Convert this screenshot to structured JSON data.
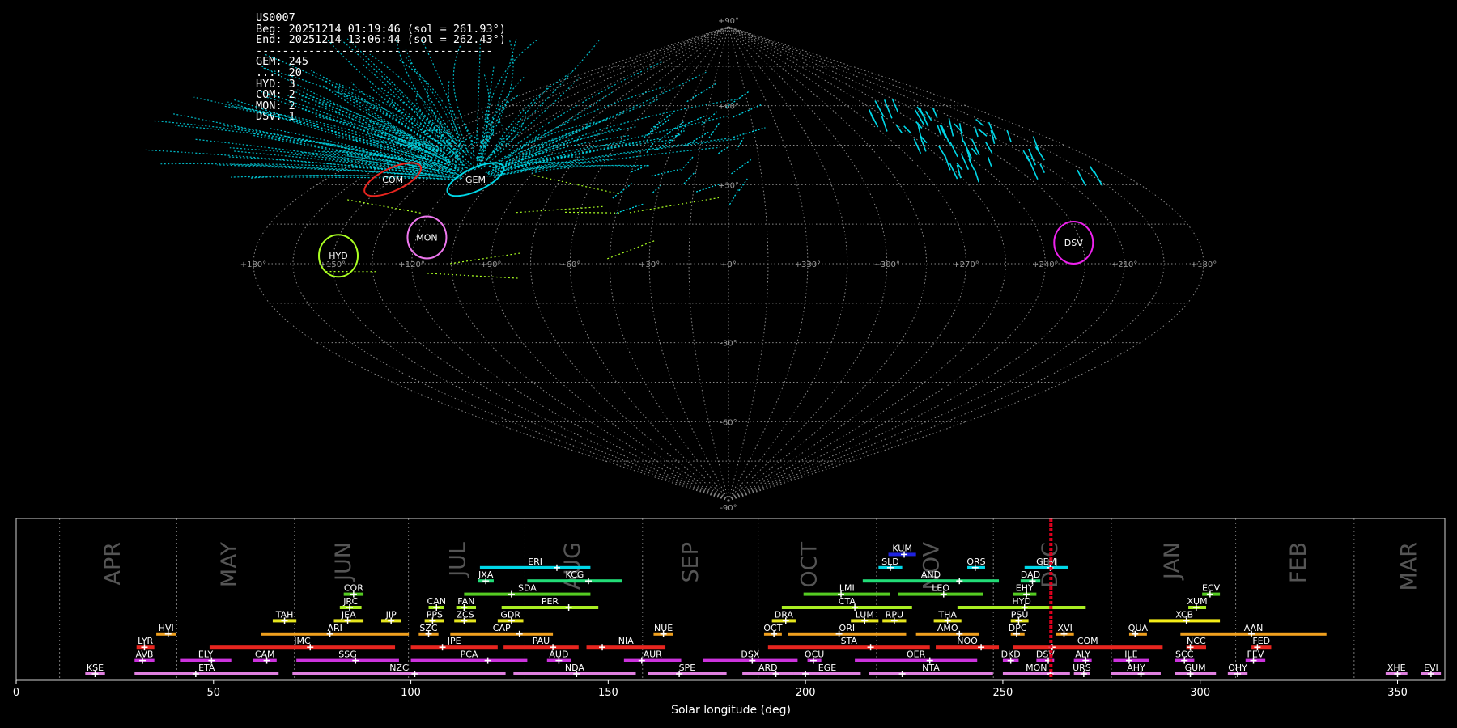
{
  "header": {
    "station": "US0007",
    "begin": "Beg: 20251214 01:19:46 (sol = 261.93°)",
    "end": "End: 20251214 13:06:44 (sol = 262.43°)",
    "separator": "------------------------------------",
    "counts": [
      "GEM: 245",
      "...: 20",
      "HYD: 3",
      "COM: 2",
      "MON: 2",
      "DSV: 1"
    ]
  },
  "chart_data": [
    {
      "type": "scatter",
      "projection": "sinusoidal",
      "center_lon": 0,
      "lon_direction": "increasing to the left",
      "lon_labels": [
        "+180°",
        "+150°",
        "+120°",
        "+90°",
        "+60°",
        "+30°",
        "+0°",
        "+330°",
        "+300°",
        "+270°",
        "+240°",
        "+210°",
        "+180°"
      ],
      "lon_ticks": [
        180,
        150,
        120,
        90,
        60,
        30,
        0,
        -30,
        -60,
        -90,
        -120,
        -150,
        -180
      ],
      "lat_labels": [
        "+90°",
        "+60°",
        "+30°",
        "-30°",
        "-60°",
        "-90°"
      ],
      "lat_ticks": [
        90,
        60,
        30,
        -30,
        -60,
        -90
      ],
      "grid": true,
      "radiants": [
        {
          "name": "COM",
          "lon": 150,
          "lat": 32,
          "color": "#e8251f"
        },
        {
          "name": "GEM",
          "lon": 113,
          "lat": 32,
          "color": "#00d8e8"
        },
        {
          "name": "HYD",
          "lon": 148,
          "lat": 3,
          "color": "#aaff22"
        },
        {
          "name": "MON",
          "lon": 116,
          "lat": 10,
          "color": "#ee77ee"
        },
        {
          "name": "DSV",
          "lon": -132,
          "lat": 8,
          "color": "#ee22ee"
        }
      ],
      "meteor_colors": {
        "GEM": "#00d8e8",
        "sporadic": "#aaff22"
      }
    },
    {
      "type": "timeline",
      "xlabel": "Solar longitude (deg)",
      "xlim": [
        0,
        362
      ],
      "xticks": [
        0,
        50,
        100,
        150,
        200,
        250,
        300,
        350
      ],
      "current_sol": [
        261.93,
        262.43
      ],
      "current_color": "#e8001f",
      "month_boundaries": [
        11,
        40.7,
        70.5,
        99.4,
        128.9,
        158.7,
        188,
        218,
        247.6,
        277.5,
        309,
        339
      ],
      "months": [
        {
          "label": "APR",
          "sol": 24.5
        },
        {
          "label": "MAY",
          "sol": 54
        },
        {
          "label": "JUN",
          "sol": 83
        },
        {
          "label": "JUL",
          "sol": 112
        },
        {
          "label": "AUG",
          "sol": 141
        },
        {
          "label": "SEP",
          "sol": 171
        },
        {
          "label": "OCT",
          "sol": 201
        },
        {
          "label": "NOV",
          "sol": 232
        },
        {
          "label": "DEC",
          "sol": 262
        },
        {
          "label": "JAN",
          "sol": 293
        },
        {
          "label": "FEB",
          "sol": 325
        },
        {
          "label": "MAR",
          "sol": 353
        }
      ],
      "showers": [
        {
          "code": "KUM",
          "start": 221,
          "end": 228,
          "peak": 225,
          "row": 9,
          "color": "#1e22e0"
        },
        {
          "code": "ERI",
          "start": 117.5,
          "end": 145.5,
          "peak": 137,
          "row": 8,
          "color": "#00d8e8"
        },
        {
          "code": "SLD",
          "start": 218.5,
          "end": 224.5,
          "peak": 221.5,
          "row": 8,
          "color": "#00d8e8"
        },
        {
          "code": "ORS",
          "start": 241,
          "end": 245.5,
          "peak": 243,
          "row": 8,
          "color": "#00d8e8"
        },
        {
          "code": "GEM",
          "start": 255.5,
          "end": 266.5,
          "peak": 262,
          "row": 8,
          "color": "#00d8e8"
        },
        {
          "code": "JXA",
          "start": 117,
          "end": 121,
          "peak": 119,
          "row": 7,
          "color": "#22dd77"
        },
        {
          "code": "KCG",
          "start": 129.5,
          "end": 153.5,
          "peak": 145,
          "row": 7,
          "color": "#22dd77"
        },
        {
          "code": "AND",
          "start": 214.5,
          "end": 249,
          "peak": 239,
          "row": 7,
          "color": "#22dd77"
        },
        {
          "code": "DAD",
          "start": 254.5,
          "end": 259.5,
          "peak": 257.5,
          "row": 7,
          "color": "#22dd77"
        },
        {
          "code": "COR",
          "start": 83,
          "end": 88,
          "peak": 85.5,
          "row": 6,
          "color": "#55cc22"
        },
        {
          "code": "SDA",
          "start": 113.5,
          "end": 145.5,
          "peak": 125.5,
          "row": 6,
          "color": "#55cc22"
        },
        {
          "code": "LMI",
          "start": 199.5,
          "end": 221.5,
          "peak": 209,
          "row": 6,
          "color": "#55cc22"
        },
        {
          "code": "LEO",
          "start": 223.5,
          "end": 245,
          "peak": 235,
          "row": 6,
          "color": "#55cc22"
        },
        {
          "code": "EHY",
          "start": 252.5,
          "end": 258.5,
          "peak": 256,
          "row": 6,
          "color": "#55cc22"
        },
        {
          "code": "ECV",
          "start": 300.5,
          "end": 305,
          "peak": 302.5,
          "row": 6,
          "color": "#55cc22"
        },
        {
          "code": "JRC",
          "start": 82,
          "end": 87.5,
          "peak": 84.5,
          "row": 5,
          "color": "#aaee22"
        },
        {
          "code": "CAN",
          "start": 104.5,
          "end": 108.5,
          "peak": 106.5,
          "row": 5,
          "color": "#aaee22"
        },
        {
          "code": "FAN",
          "start": 111.5,
          "end": 116.5,
          "peak": 113.5,
          "row": 5,
          "color": "#aaee22"
        },
        {
          "code": "PER",
          "start": 123,
          "end": 147.5,
          "peak": 140,
          "row": 5,
          "color": "#aaee22"
        },
        {
          "code": "CTA",
          "start": 194,
          "end": 227,
          "peak": 212.5,
          "row": 5,
          "color": "#aaee22"
        },
        {
          "code": "HYD",
          "start": 238.5,
          "end": 271,
          "peak": 255.5,
          "row": 5,
          "color": "#aaee22"
        },
        {
          "code": "XUM",
          "start": 297,
          "end": 301.5,
          "peak": 299,
          "row": 5,
          "color": "#aaee22"
        },
        {
          "code": "TAH",
          "start": 65,
          "end": 71,
          "peak": 68,
          "row": 4,
          "color": "#e6e61e"
        },
        {
          "code": "JEA",
          "start": 80.5,
          "end": 88,
          "peak": 84,
          "row": 4,
          "color": "#e6e61e"
        },
        {
          "code": "JIP",
          "start": 92.5,
          "end": 97.5,
          "peak": 95,
          "row": 4,
          "color": "#e6e61e"
        },
        {
          "code": "PPS",
          "start": 103.5,
          "end": 108.5,
          "peak": 105.5,
          "row": 4,
          "color": "#e6e61e"
        },
        {
          "code": "ZCS",
          "start": 111,
          "end": 116.5,
          "peak": 113.5,
          "row": 4,
          "color": "#e6e61e"
        },
        {
          "code": "GDR",
          "start": 122,
          "end": 128.5,
          "peak": 125.5,
          "row": 4,
          "color": "#e6e61e"
        },
        {
          "code": "DRA",
          "start": 191.5,
          "end": 197.5,
          "peak": 195,
          "row": 4,
          "color": "#e6e61e"
        },
        {
          "code": "LUM",
          "start": 211.5,
          "end": 218.5,
          "peak": 215,
          "row": 4,
          "color": "#e6e61e"
        },
        {
          "code": "RPU",
          "start": 219.5,
          "end": 225.5,
          "peak": 222.5,
          "row": 4,
          "color": "#e6e61e"
        },
        {
          "code": "THA",
          "start": 232.5,
          "end": 239.5,
          "peak": 236,
          "row": 4,
          "color": "#e6e61e"
        },
        {
          "code": "PSU",
          "start": 252,
          "end": 256.5,
          "peak": 254,
          "row": 4,
          "color": "#e6e61e"
        },
        {
          "code": "XCB",
          "start": 287,
          "end": 305,
          "peak": 296.5,
          "row": 4,
          "color": "#f5ee18"
        },
        {
          "code": "HVI",
          "start": 35.5,
          "end": 40.5,
          "peak": 38.5,
          "row": 3,
          "color": "#f0a01e"
        },
        {
          "code": "ARI",
          "start": 62,
          "end": 99.5,
          "peak": 79.5,
          "row": 3,
          "color": "#f0a01e"
        },
        {
          "code": "SZC",
          "start": 102,
          "end": 107,
          "peak": 104.5,
          "row": 3,
          "color": "#f0a01e"
        },
        {
          "code": "CAP",
          "start": 110,
          "end": 136,
          "peak": 127.5,
          "row": 3,
          "color": "#f0a01e"
        },
        {
          "code": "NUE",
          "start": 161.5,
          "end": 166.5,
          "peak": 164,
          "row": 3,
          "color": "#f0a01e"
        },
        {
          "code": "OCT",
          "start": 189.5,
          "end": 194,
          "peak": 192,
          "row": 3,
          "color": "#f0a01e"
        },
        {
          "code": "ORI",
          "start": 195.5,
          "end": 225.5,
          "peak": 208.5,
          "row": 3,
          "color": "#f0a01e"
        },
        {
          "code": "AMO",
          "start": 228,
          "end": 244,
          "peak": 239,
          "row": 3,
          "color": "#f0a01e"
        },
        {
          "code": "DPC",
          "start": 252,
          "end": 255.5,
          "peak": 253.5,
          "row": 3,
          "color": "#f0a01e"
        },
        {
          "code": "XVI",
          "start": 263.5,
          "end": 268,
          "peak": 265.5,
          "row": 3,
          "color": "#f0a01e"
        },
        {
          "code": "QUA",
          "start": 282,
          "end": 286.5,
          "peak": 283.5,
          "row": 3,
          "color": "#f0a01e"
        },
        {
          "code": "AAN",
          "start": 295,
          "end": 332,
          "peak": 313,
          "row": 3,
          "color": "#f0a01e"
        },
        {
          "code": "LYR",
          "start": 30.5,
          "end": 35,
          "peak": 32.5,
          "row": 2,
          "color": "#e8251f"
        },
        {
          "code": "JMC",
          "start": 49,
          "end": 96,
          "peak": 74.5,
          "row": 2,
          "color": "#e8251f"
        },
        {
          "code": "JPE",
          "start": 100,
          "end": 122,
          "peak": 108,
          "row": 2,
          "color": "#e8251f"
        },
        {
          "code": "PAU",
          "start": 123.5,
          "end": 142.5,
          "peak": 136,
          "row": 2,
          "color": "#e8251f"
        },
        {
          "code": "NIA",
          "start": 144.5,
          "end": 164.5,
          "peak": 148.5,
          "row": 2,
          "color": "#e8251f"
        },
        {
          "code": "STA",
          "start": 190.5,
          "end": 231.5,
          "peak": 216.5,
          "row": 2,
          "color": "#e8251f"
        },
        {
          "code": "NOO",
          "start": 233,
          "end": 249,
          "peak": 244.5,
          "row": 2,
          "color": "#e8251f"
        },
        {
          "code": "COM",
          "start": 252.5,
          "end": 290.5,
          "peak": 262.5,
          "row": 2,
          "color": "#e8251f"
        },
        {
          "code": "NCC",
          "start": 296.5,
          "end": 301.5,
          "peak": 297.5,
          "row": 2,
          "color": "#e8251f"
        },
        {
          "code": "FED",
          "start": 313,
          "end": 318,
          "peak": 314.5,
          "row": 2,
          "color": "#e8251f"
        },
        {
          "code": "AVB",
          "start": 30,
          "end": 35,
          "peak": 32,
          "row": 1,
          "color": "#cc33dd"
        },
        {
          "code": "ELY",
          "start": 41.5,
          "end": 54.5,
          "peak": 49.5,
          "row": 1,
          "color": "#cc33dd"
        },
        {
          "code": "CAM",
          "start": 60,
          "end": 66,
          "peak": 63.5,
          "row": 1,
          "color": "#cc33dd"
        },
        {
          "code": "SSG",
          "start": 71,
          "end": 97,
          "peak": 86,
          "row": 1,
          "color": "#cc33dd"
        },
        {
          "code": "PCA",
          "start": 100,
          "end": 129.5,
          "peak": 119.5,
          "row": 1,
          "color": "#cc33dd"
        },
        {
          "code": "AUD",
          "start": 134.5,
          "end": 140.5,
          "peak": 137.5,
          "row": 1,
          "color": "#cc33dd"
        },
        {
          "code": "AUR",
          "start": 154,
          "end": 168.5,
          "peak": 158.5,
          "row": 1,
          "color": "#cc33dd"
        },
        {
          "code": "DSX",
          "start": 174,
          "end": 198,
          "peak": 186.5,
          "row": 1,
          "color": "#cc33dd"
        },
        {
          "code": "OCU",
          "start": 200.5,
          "end": 204,
          "peak": 202,
          "row": 1,
          "color": "#cc33dd"
        },
        {
          "code": "OER",
          "start": 212.5,
          "end": 243.5,
          "peak": 231.5,
          "row": 1,
          "color": "#cc33dd"
        },
        {
          "code": "DKD",
          "start": 250,
          "end": 254,
          "peak": 252,
          "row": 1,
          "color": "#cc33dd"
        },
        {
          "code": "DSV",
          "start": 258.5,
          "end": 263,
          "peak": 261.5,
          "row": 1,
          "color": "#cc33dd"
        },
        {
          "code": "ALY",
          "start": 268,
          "end": 272.5,
          "peak": 271,
          "row": 1,
          "color": "#cc33dd"
        },
        {
          "code": "ILE",
          "start": 278,
          "end": 287,
          "peak": 282,
          "row": 1,
          "color": "#cc33dd"
        },
        {
          "code": "SCC",
          "start": 293.5,
          "end": 298.5,
          "peak": 296,
          "row": 1,
          "color": "#cc33dd"
        },
        {
          "code": "FEV",
          "start": 311.5,
          "end": 316.5,
          "peak": 313.5,
          "row": 1,
          "color": "#cc33dd"
        },
        {
          "code": "KSE",
          "start": 17.5,
          "end": 22.5,
          "peak": 20,
          "row": 0,
          "color": "#e080e0"
        },
        {
          "code": "ETA",
          "start": 30,
          "end": 66.5,
          "peak": 45.5,
          "row": 0,
          "color": "#e080e0"
        },
        {
          "code": "NZC",
          "start": 70,
          "end": 124,
          "peak": 101,
          "row": 0,
          "color": "#e080e0"
        },
        {
          "code": "NDA",
          "start": 126,
          "end": 157,
          "peak": 142,
          "row": 0,
          "color": "#e080e0"
        },
        {
          "code": "SPE",
          "start": 160,
          "end": 180,
          "peak": 168,
          "row": 0,
          "color": "#e080e0"
        },
        {
          "code": "ARD",
          "start": 184,
          "end": 197,
          "peak": 192.5,
          "row": 0,
          "color": "#e080e0"
        },
        {
          "code": "EGE",
          "start": 197,
          "end": 214,
          "peak": 200,
          "row": 0,
          "color": "#e080e0"
        },
        {
          "code": "NTA",
          "start": 216,
          "end": 247.5,
          "peak": 224.5,
          "row": 0,
          "color": "#e080e0"
        },
        {
          "code": "MON",
          "start": 250,
          "end": 267,
          "peak": 262,
          "row": 0,
          "color": "#e080e0"
        },
        {
          "code": "URS",
          "start": 268,
          "end": 272,
          "peak": 270.5,
          "row": 0,
          "color": "#e080e0"
        },
        {
          "code": "AHY",
          "start": 277.5,
          "end": 290,
          "peak": 285,
          "row": 0,
          "color": "#e080e0"
        },
        {
          "code": "GUM",
          "start": 293.5,
          "end": 304,
          "peak": 297.5,
          "row": 0,
          "color": "#e080e0"
        },
        {
          "code": "OHY",
          "start": 307,
          "end": 312,
          "peak": 309.5,
          "row": 0,
          "color": "#e080e0"
        },
        {
          "code": "XHE",
          "start": 347,
          "end": 352.5,
          "peak": 350,
          "row": 0,
          "color": "#e080e0"
        },
        {
          "code": "EVI",
          "start": 356,
          "end": 361,
          "peak": 358.5,
          "row": 0,
          "color": "#e080e0"
        }
      ]
    }
  ]
}
